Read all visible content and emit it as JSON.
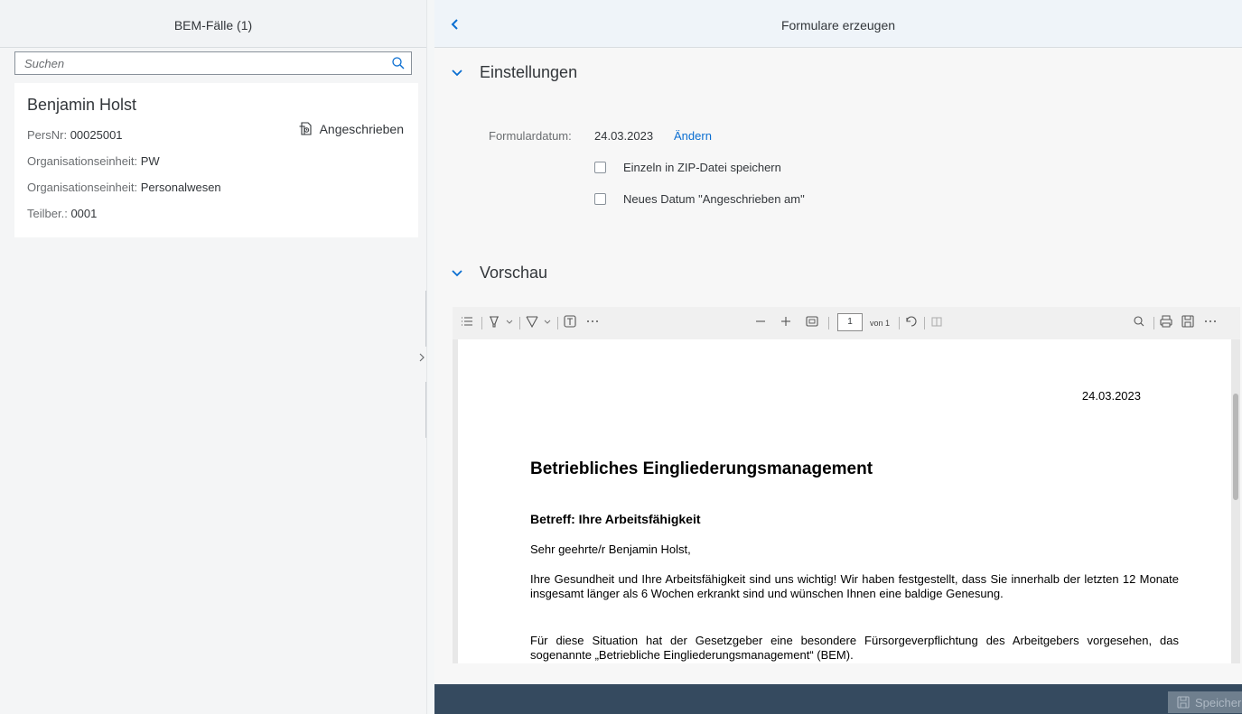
{
  "master": {
    "title": "BEM-Fälle (1)",
    "search_placeholder": "Suchen",
    "item": {
      "name": "Benjamin Holst",
      "status": "Angeschrieben",
      "attributes": [
        {
          "label": "PersNr:",
          "value": "00025001"
        },
        {
          "label": "Organisationseinheit:",
          "value": "PW"
        },
        {
          "label": "Organisationseinheit:",
          "value": "Personalwesen"
        },
        {
          "label": "Teilber.:",
          "value": "0001"
        }
      ]
    }
  },
  "detail": {
    "title": "Formulare erzeugen",
    "settings": {
      "title": "Einstellungen",
      "date_label": "Formulardatum:",
      "date_value": "24.03.2023",
      "change_link": "Ändern",
      "checkbox_zip": "Einzeln in ZIP-Datei speichern",
      "checkbox_new_date": "Neues Datum \"Angeschrieben am\"",
      "checkbox_zip_checked": false,
      "checkbox_new_date_checked": false
    },
    "preview": {
      "title": "Vorschau",
      "viewer": {
        "page_number": "1",
        "page_of": "von 1"
      },
      "document": {
        "date": "24.03.2023",
        "heading": "Betriebliches Eingliederungsmanagement",
        "subject": "Betreff: Ihre Arbeitsfähigkeit",
        "greeting": "Sehr geehrte/r Benjamin Holst,",
        "paragraph1": "Ihre Gesundheit und Ihre Arbeitsfähigkeit sind uns wichtig! Wir haben festgestellt, dass Sie innerhalb der letzten 12 Monate insgesamt länger als 6 Wochen erkrankt sind und wünschen Ihnen eine baldige Genesung.",
        "paragraph2": "Für diese Situation hat der Gesetzgeber eine besondere Fürsorgeverpflichtung des Arbeitgebers vorgesehen, das sogenannte „Betriebliche Eingliederungsmanagement“ (BEM)."
      }
    }
  },
  "footer": {
    "save_label": "Speichern"
  },
  "colors": {
    "link": "#0a6ed1",
    "footer": "#354a5f"
  }
}
